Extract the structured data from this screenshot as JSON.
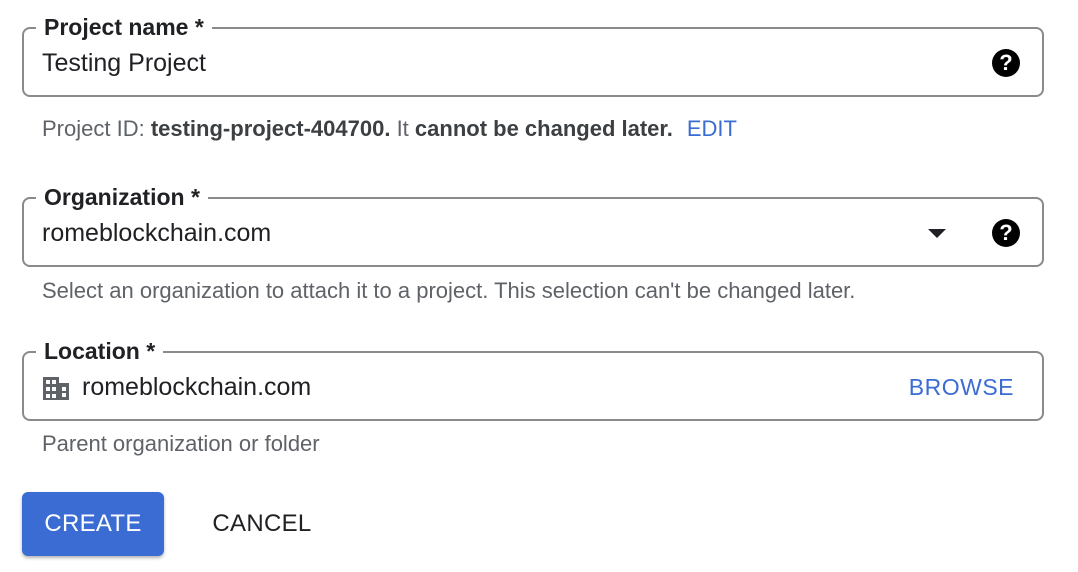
{
  "project_name": {
    "label": "Project name *",
    "value": "Testing Project",
    "help_icon": "help-circle-icon"
  },
  "project_id": {
    "prefix": "Project ID: ",
    "id": "testing-project-404700.",
    "middle": " It ",
    "warning": "cannot be changed later.",
    "edit_label": "EDIT"
  },
  "organization": {
    "label": "Organization *",
    "value": "romeblockchain.com",
    "dropdown_icon": "dropdown-arrow-icon",
    "help_icon": "help-circle-icon",
    "hint": "Select an organization to attach it to a project. This selection can't be changed later."
  },
  "location": {
    "label": "Location *",
    "icon": "building-icon",
    "value": "romeblockchain.com",
    "browse_label": "BROWSE",
    "hint": "Parent organization or folder"
  },
  "actions": {
    "create_label": "CREATE",
    "cancel_label": "CANCEL"
  },
  "colors": {
    "accent": "#3b6cd4",
    "text": "#202124",
    "hint": "#5f6368",
    "border": "#8a8a8a"
  }
}
